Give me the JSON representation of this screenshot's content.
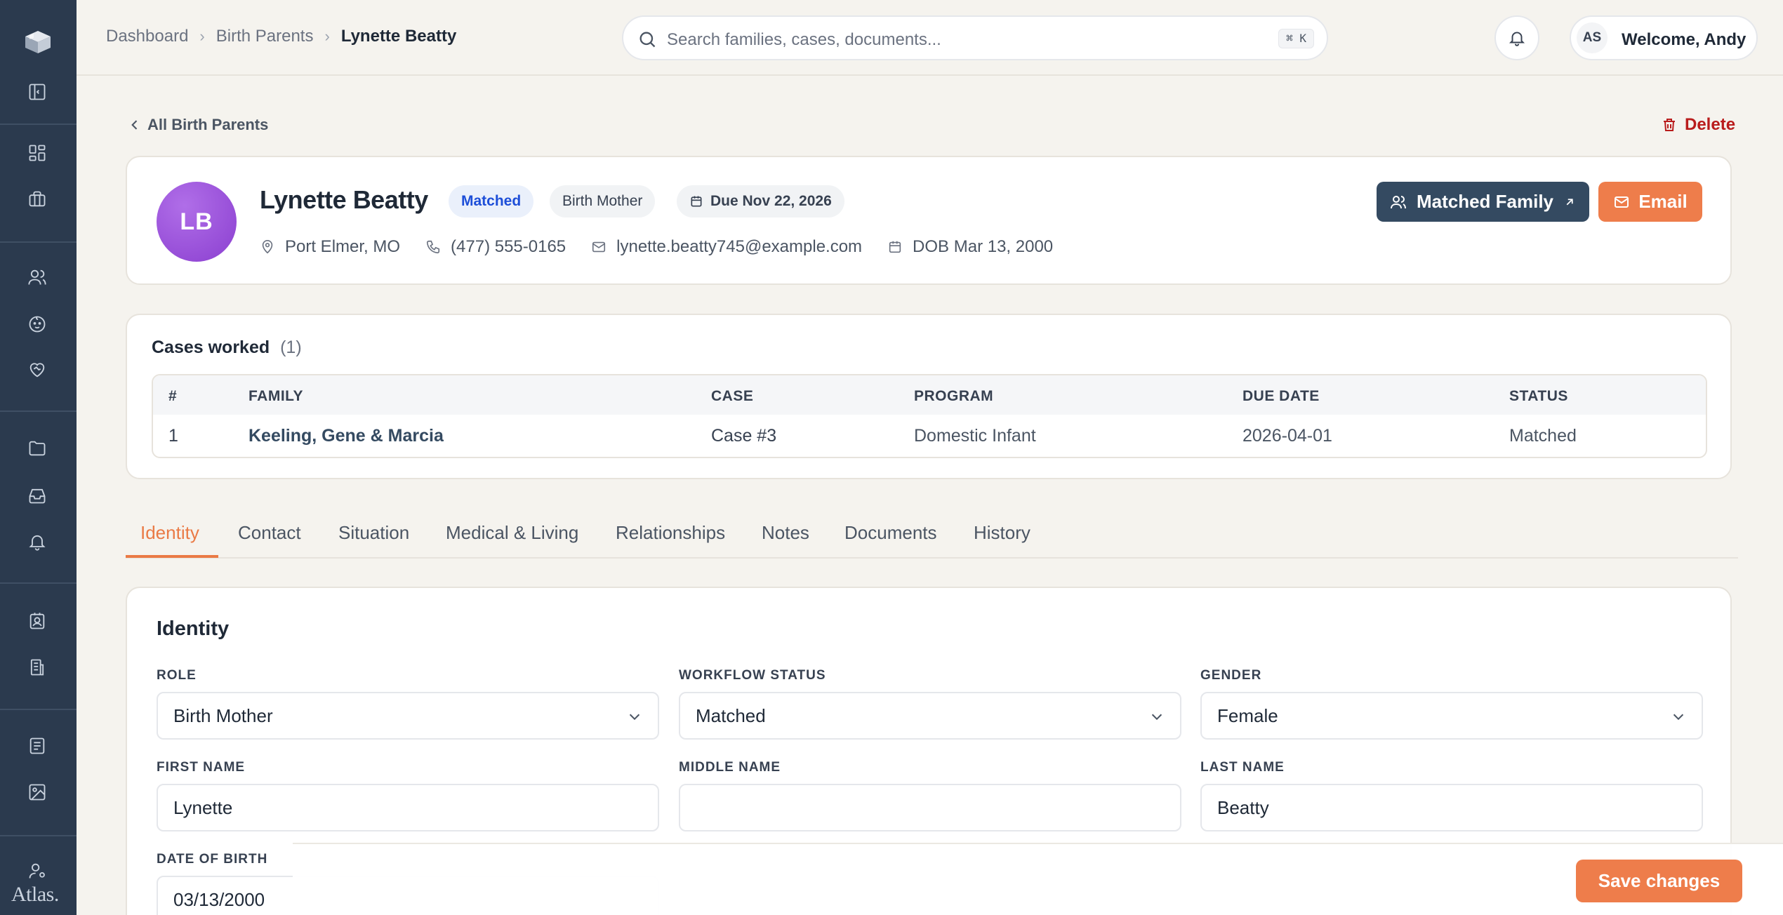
{
  "app": {
    "brand": "Atlas."
  },
  "breadcrumb": [
    "Dashboard",
    "Birth Parents",
    "Lynette Beatty"
  ],
  "search": {
    "placeholder": "Search families, cases, documents...",
    "shortcut": "⌘ K"
  },
  "user": {
    "initials": "AS",
    "welcome": "Welcome, Andy"
  },
  "page": {
    "back_label": "All Birth Parents",
    "delete_label": "Delete"
  },
  "profile": {
    "initials": "LB",
    "name": "Lynette Beatty",
    "status_badge": "Matched",
    "role_badge": "Birth Mother",
    "due_badge": "Due Nov 22, 2026",
    "location": "Port Elmer, MO",
    "phone": "(477) 555-0165",
    "email": "lynette.beatty745@example.com",
    "dob": "DOB Mar 13, 2000",
    "matched_family_label": "Matched Family",
    "email_button_label": "Email"
  },
  "cases": {
    "title": "Cases worked",
    "count": "(1)",
    "columns": [
      "#",
      "FAMILY",
      "CASE",
      "PROGRAM",
      "DUE DATE",
      "STATUS"
    ],
    "rows": [
      {
        "num": "1",
        "family": "Keeling, Gene & Marcia",
        "case": "Case #3",
        "program": "Domestic Infant",
        "due_date": "2026-04-01",
        "status": "Matched"
      }
    ]
  },
  "tabs": [
    "Identity",
    "Contact",
    "Situation",
    "Medical & Living",
    "Relationships",
    "Notes",
    "Documents",
    "History"
  ],
  "active_tab": "Identity",
  "identity": {
    "title": "Identity",
    "role": {
      "label": "ROLE",
      "value": "Birth Mother"
    },
    "workflow_status": {
      "label": "WORKFLOW STATUS",
      "value": "Matched"
    },
    "gender": {
      "label": "GENDER",
      "value": "Female"
    },
    "first_name": {
      "label": "FIRST NAME",
      "value": "Lynette"
    },
    "middle_name": {
      "label": "MIDDLE NAME",
      "value": ""
    },
    "last_name": {
      "label": "LAST NAME",
      "value": "Beatty"
    },
    "date_of_birth": {
      "label": "DATE OF BIRTH",
      "value": "03/13/2000"
    }
  },
  "save_bar": {
    "save_label": "Save changes"
  },
  "colors": {
    "sidebar": "#2b3a4e",
    "accent": "#ee7d4b",
    "primary_button": "#344a61",
    "danger": "#b91c1c",
    "matched_badge": "#1d4ed8"
  }
}
